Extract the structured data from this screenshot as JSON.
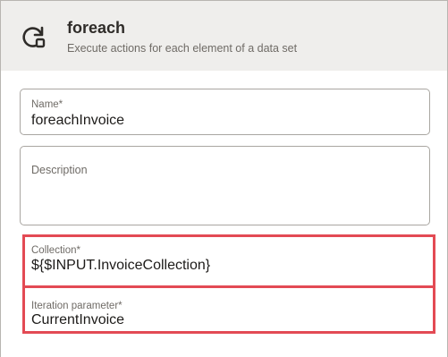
{
  "header": {
    "icon": "refresh-loop-icon",
    "title": "foreach",
    "subtitle": "Execute actions for each element of a data set"
  },
  "form": {
    "name": {
      "label": "Name*",
      "value": "foreachInvoice"
    },
    "description": {
      "label": "Description",
      "value": ""
    },
    "collection": {
      "label": "Collection*",
      "value": "${$INPUT.InvoiceCollection}"
    },
    "iteration_parameter": {
      "label": "Iteration parameter*",
      "value": "CurrentInvoice"
    }
  },
  "colors": {
    "header_bg": "#efeeec",
    "highlight": "#e34a54",
    "field_border": "#a9a6a1"
  }
}
